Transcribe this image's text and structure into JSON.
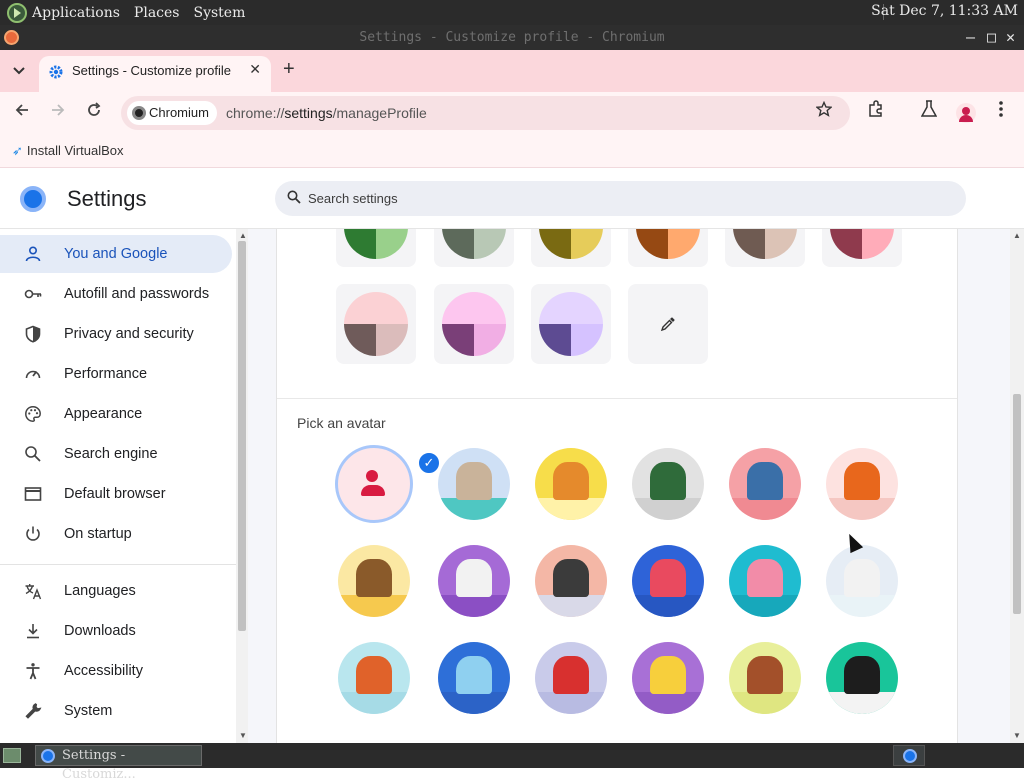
{
  "panel": {
    "menus": [
      "Applications",
      "Places",
      "System"
    ],
    "clock": "Sat Dec  7, 11:33 AM"
  },
  "window": {
    "title": "Settings - Customize profile - Chromium",
    "controls": [
      "—",
      "□",
      "✕"
    ]
  },
  "browser": {
    "tab_title": "Settings - Customize profile",
    "tab_close": "✕",
    "new_tab": "+",
    "site_chip": "Chromium",
    "url_scheme": "chrome://",
    "url_host": "settings",
    "url_path": "/manageProfile",
    "bookmark": "Install VirtualBox",
    "icons": [
      "back-icon",
      "forward-icon",
      "reload-icon",
      "star-icon",
      "extensions-icon",
      "labs-icon",
      "profile-icon",
      "menu-icon"
    ]
  },
  "settings": {
    "title": "Settings",
    "search_placeholder": "Search settings",
    "nav": [
      {
        "label": "You and Google",
        "icon": "person-icon",
        "active": true
      },
      {
        "label": "Autofill and passwords",
        "icon": "key-icon"
      },
      {
        "label": "Privacy and security",
        "icon": "shield-icon"
      },
      {
        "label": "Performance",
        "icon": "gauge-icon"
      },
      {
        "label": "Appearance",
        "icon": "palette-icon"
      },
      {
        "label": "Search engine",
        "icon": "search-icon"
      },
      {
        "label": "Default browser",
        "icon": "browser-window-icon"
      },
      {
        "label": "On startup",
        "icon": "power-icon"
      },
      {
        "label": "Languages",
        "icon": "translate-icon"
      },
      {
        "label": "Downloads",
        "icon": "download-icon"
      },
      {
        "label": "Accessibility",
        "icon": "accessibility-icon"
      },
      {
        "label": "System",
        "icon": "wrench-icon"
      }
    ]
  },
  "profile": {
    "color_swatches": [
      {
        "top": "#99d08b",
        "bl": "#2e7b32",
        "br": "#99d08b"
      },
      {
        "top": "#b8c8b5",
        "bl": "#5d6a5b",
        "br": "#b8c8b5"
      },
      {
        "top": "#e6cc5a",
        "bl": "#7a6a12",
        "br": "#e6cc5a"
      },
      {
        "top": "#ffa96e",
        "bl": "#964913",
        "br": "#ffa96e"
      },
      {
        "top": "#dcc3b6",
        "bl": "#6f5b52",
        "br": "#dcc3b6"
      },
      {
        "top": "#ffacb9",
        "bl": "#8f3a4d",
        "br": "#ffacb9"
      },
      {
        "top": "#fbd1d4",
        "bl": "#6f5b5a",
        "br": "#dbbcbb"
      },
      {
        "top": "#fdc6ef",
        "bl": "#7a3f78",
        "br": "#f1aee4"
      },
      {
        "top": "#e4d4ff",
        "bl": "#5d4b92",
        "br": "#d5c2ff"
      }
    ],
    "custom_color_icon": "eyedropper-icon",
    "avatar_title": "Pick an avatar",
    "selected_check": "✓",
    "avatars": [
      {
        "name": "avatar-default-person",
        "bg": "#fde6e9"
      },
      {
        "name": "avatar-cat",
        "bg": "#cfe0f5",
        "ground": "#4fc7c2",
        "fig": "#c9b39a"
      },
      {
        "name": "avatar-fox-corgi",
        "bg": "#f7dd4a",
        "ground": "#fff2a8",
        "fig": "#e58a2c"
      },
      {
        "name": "avatar-dragon",
        "bg": "#e2e2e2",
        "ground": "#d0d0d0",
        "fig": "#2f6b3a"
      },
      {
        "name": "avatar-elephant",
        "bg": "#f5a1a6",
        "ground": "#f08a92",
        "fig": "#3a6fa8"
      },
      {
        "name": "avatar-fox",
        "bg": "#fde2e0",
        "ground": "#f5c7c2",
        "fig": "#e8671c"
      },
      {
        "name": "avatar-monkey",
        "bg": "#fbe8a3",
        "ground": "#f6c94e",
        "fig": "#8a5a2a"
      },
      {
        "name": "avatar-panda",
        "bg": "#a56ad6",
        "ground": "#8b4fc4",
        "fig": "#f2f2f2"
      },
      {
        "name": "avatar-penguin",
        "bg": "#f4b7a6",
        "ground": "#d9d9e8",
        "fig": "#3b3b3b"
      },
      {
        "name": "avatar-butterfly",
        "bg": "#2e63d8",
        "ground": "#2757c2",
        "fig": "#e94a5f"
      },
      {
        "name": "avatar-rabbit",
        "bg": "#1fbcd0",
        "ground": "#17a8bb",
        "fig": "#f28ca8"
      },
      {
        "name": "avatar-unicorn",
        "bg": "#e6edf5",
        "ground": "#e9f3f7",
        "fig": "#f2f2f2"
      },
      {
        "name": "avatar-basketball",
        "bg": "#b9e6ee",
        "ground": "#a6dbe6",
        "fig": "#e0622a"
      },
      {
        "name": "avatar-bike",
        "bg": "#2e6fd8",
        "ground": "#2c63c7",
        "fig": "#8fd0f0"
      },
      {
        "name": "avatar-bird",
        "bg": "#c9cbea",
        "ground": "#b8bbe2",
        "fig": "#d8302f"
      },
      {
        "name": "avatar-cheese",
        "bg": "#a870d6",
        "ground": "#935cc6",
        "fig": "#f7cf3c"
      },
      {
        "name": "avatar-football",
        "bg": "#e8ef9a",
        "ground": "#dfe681",
        "fig": "#a3502a"
      },
      {
        "name": "avatar-sushi",
        "bg": "#19c59a",
        "ground": "#f3f3f3",
        "fig": "#1d1d1d"
      }
    ]
  },
  "taskbar": {
    "task_label": "Settings - Customiz..."
  }
}
